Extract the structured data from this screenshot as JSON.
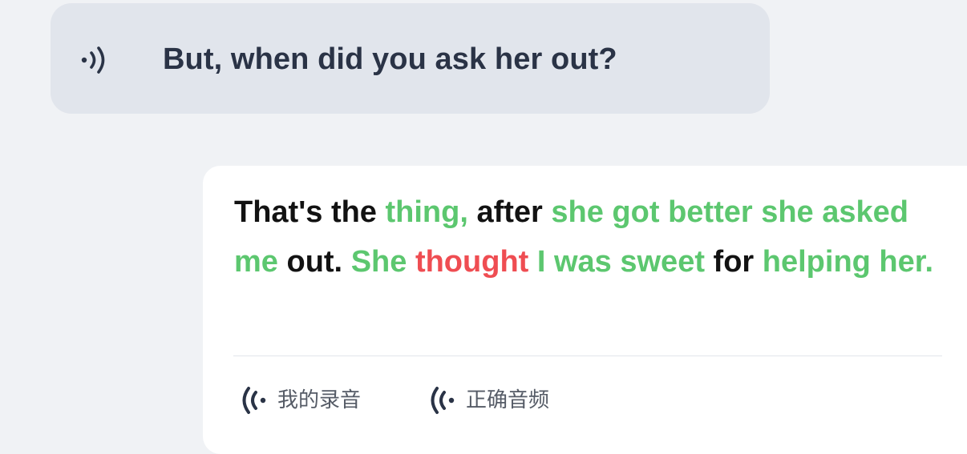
{
  "prompt": {
    "icon": "speaker-icon",
    "text": "But, when did you ask her out?"
  },
  "answer": {
    "words": [
      {
        "text": "That's the ",
        "status": "black"
      },
      {
        "text": "thing,",
        "status": "green"
      },
      {
        "text": " after ",
        "status": "black"
      },
      {
        "text": "she got better she asked me",
        "status": "green"
      },
      {
        "text": " out. ",
        "status": "black"
      },
      {
        "text": "She ",
        "status": "green"
      },
      {
        "text": "thought",
        "status": "red"
      },
      {
        "text": " I was sweet",
        "status": "green"
      },
      {
        "text": " for ",
        "status": "black"
      },
      {
        "text": "helping her.",
        "status": "green"
      }
    ]
  },
  "buttons": {
    "my_recording": {
      "label": "我的录音",
      "icon": "sound-wave-icon"
    },
    "correct_audio": {
      "label": "正确音频",
      "icon": "sound-wave-icon"
    }
  },
  "colors": {
    "correct": "#5cc76f",
    "incorrect": "#ef4d52",
    "neutral": "#121212",
    "page_background": "#f0f2f5",
    "prompt_bubble": "#e1e5ec",
    "card": "#ffffff"
  }
}
